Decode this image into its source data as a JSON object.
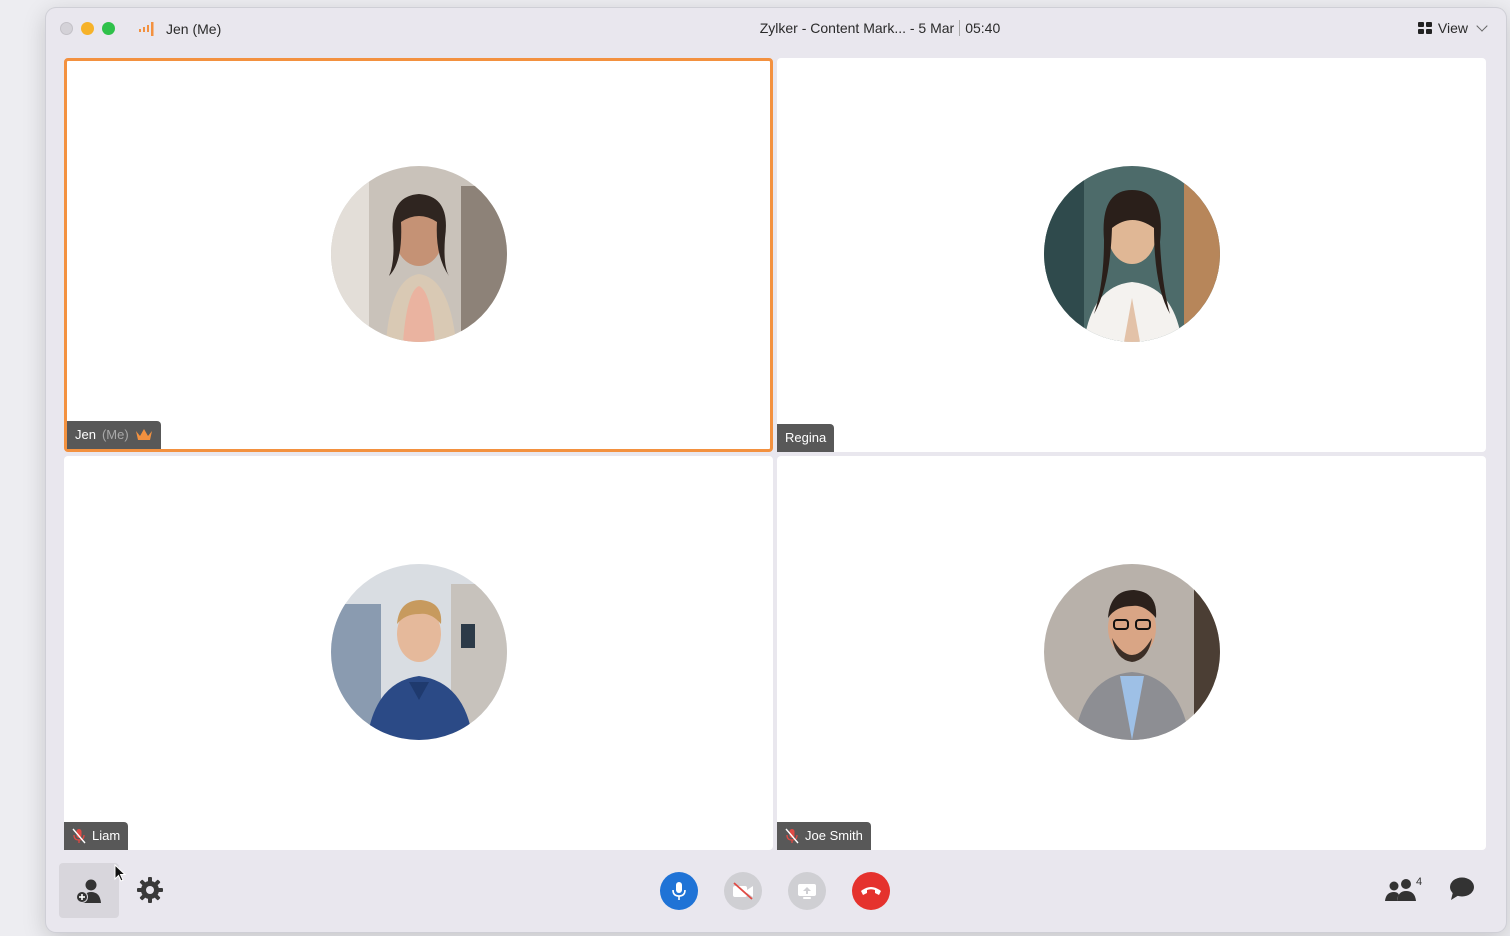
{
  "titlebar": {
    "me_name": "Jen (Me)",
    "meeting_title": "Zylker - Content Mark... - 5 Mar",
    "duration": "05:40",
    "view_label": "View"
  },
  "participants": [
    {
      "name": "Jen",
      "suffix": "(Me)",
      "host": true,
      "muted": false,
      "active_speaker": true
    },
    {
      "name": "Regina",
      "suffix": "",
      "host": false,
      "muted": false,
      "active_speaker": false
    },
    {
      "name": "Liam",
      "suffix": "",
      "host": false,
      "muted": true,
      "active_speaker": false
    },
    {
      "name": "Joe Smith",
      "suffix": "",
      "host": false,
      "muted": true,
      "active_speaker": false
    }
  ],
  "bottombar": {
    "participant_count": "4"
  },
  "colors": {
    "active_border": "#f3913f",
    "mic_button": "#1f73d6",
    "end_call": "#e5322d",
    "name_tag_bg": "#585858"
  }
}
